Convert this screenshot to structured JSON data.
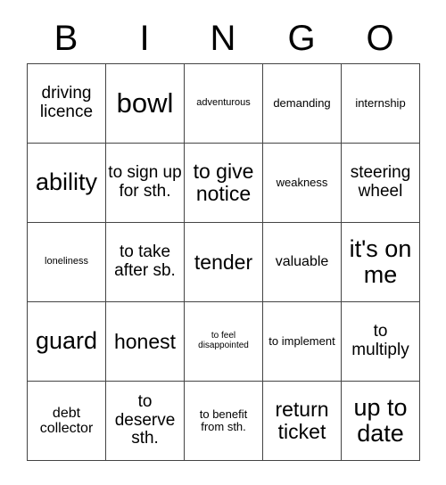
{
  "card": {
    "header_letters": [
      "B",
      "I",
      "N",
      "G",
      "O"
    ],
    "columns": 5,
    "rows": 5,
    "border_color": "#444444",
    "background_color": "#ffffff",
    "text_color": "#000000",
    "cells": [
      {
        "text": "driving licence",
        "size": "md"
      },
      {
        "text": "bowl",
        "size": "xxl"
      },
      {
        "text": "adventurous",
        "size": "xxs"
      },
      {
        "text": "demanding",
        "size": "xs"
      },
      {
        "text": "internship",
        "size": "xs"
      },
      {
        "text": "ability",
        "size": "xl"
      },
      {
        "text": "to sign up for sth.",
        "size": "md"
      },
      {
        "text": "to give notice",
        "size": "lg"
      },
      {
        "text": "weakness",
        "size": "xs"
      },
      {
        "text": "steering wheel",
        "size": "md"
      },
      {
        "text": "loneliness",
        "size": "xxs"
      },
      {
        "text": "to take after sb.",
        "size": "md"
      },
      {
        "text": "tender",
        "size": "lg"
      },
      {
        "text": "valuable",
        "size": "sm"
      },
      {
        "text": "it's on me",
        "size": "xl"
      },
      {
        "text": "guard",
        "size": "xl"
      },
      {
        "text": "honest",
        "size": "lg"
      },
      {
        "text": "to feel disappointed",
        "size": "tiny"
      },
      {
        "text": "to implement",
        "size": "xs"
      },
      {
        "text": "to multiply",
        "size": "md"
      },
      {
        "text": "debt collector",
        "size": "sm"
      },
      {
        "text": "to deserve sth.",
        "size": "md"
      },
      {
        "text": "to benefit from sth.",
        "size": "xs"
      },
      {
        "text": "return ticket",
        "size": "lg"
      },
      {
        "text": "up to date",
        "size": "xl"
      }
    ]
  }
}
